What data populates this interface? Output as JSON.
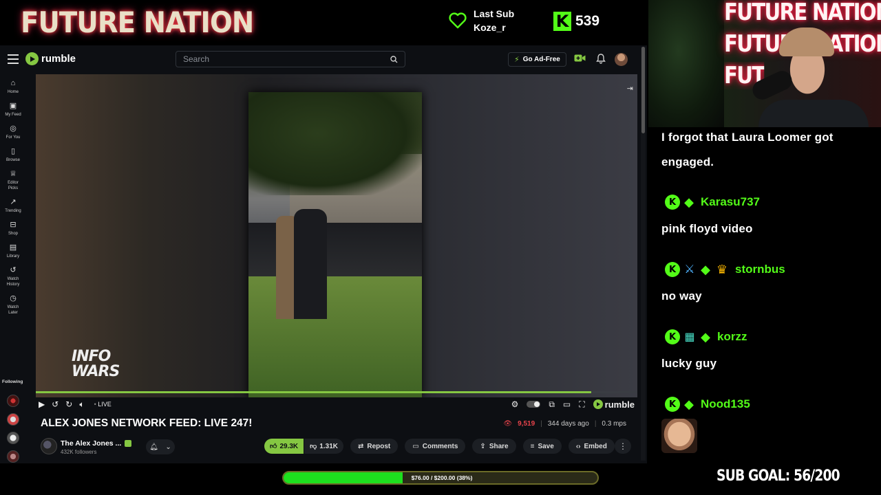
{
  "overlay": {
    "brand_title": "FUTURE NATION",
    "last_sub_label": "Last Sub",
    "last_sub_user": "Koze_r",
    "viewer_count": "539",
    "kick_logo": "K",
    "webcam_neon": [
      "FUTURE NATION",
      "FUTURE NATION",
      "FUTURE NATION"
    ],
    "goal_bar_text": "$76.00 / $200.00 (38%)",
    "goal_bar_progress": 0.38,
    "sub_goal": "SUB GOAL: 56/200",
    "accent_color": "#53fc18"
  },
  "rumble": {
    "logo": "rumble",
    "search_placeholder": "Search",
    "ad_free": "Go Ad-Free",
    "sidebar": [
      {
        "icon": "home-icon",
        "label": "Home"
      },
      {
        "icon": "my-feed-icon",
        "label": "My Feed"
      },
      {
        "icon": "for-you-icon",
        "label": "For You"
      },
      {
        "icon": "browse-icon",
        "label": "Browse"
      },
      {
        "icon": "editor-picks-icon",
        "label": "Editor Picks"
      },
      {
        "icon": "trending-icon",
        "label": "Trending"
      },
      {
        "icon": "shop-icon",
        "label": "Shop"
      },
      {
        "icon": "library-icon",
        "label": "Library"
      },
      {
        "icon": "watch-history-icon",
        "label": "Watch History"
      },
      {
        "icon": "watch-later-icon",
        "label": "Watch Later"
      }
    ],
    "following_label": "Following",
    "player": {
      "watermark": "INFO WARS",
      "live_label": "LIVE",
      "progress": 0.923,
      "logo": "rumble"
    },
    "video": {
      "title": "ALEX JONES NETWORK FEED: LIVE 247!",
      "views": "9,519",
      "time_ago": "344 days ago",
      "bitrate": "0.3 mps",
      "channel_name": "The Alex Jones ...",
      "followers": "432K followers",
      "likes": "29.3K",
      "dislikes": "1.31K",
      "repost": "Repost",
      "comments": "Comments",
      "share": "Share",
      "save": "Save",
      "embed": "Embed"
    },
    "accent_color": "#85c742"
  },
  "chat": {
    "partial_message": [
      "I forgot that Laura Loomer got",
      "engaged."
    ],
    "messages": [
      {
        "user": "Karasu737",
        "text": "pink floyd video",
        "badges": [
          "kick-icon",
          "sub-diamond-icon"
        ]
      },
      {
        "user": "stornbus",
        "text": "no way",
        "badges": [
          "kick-icon",
          "sword-icon",
          "sub-diamond-icon",
          "crown-icon"
        ]
      },
      {
        "user": "korzz",
        "text": "lucky guy",
        "badges": [
          "kick-icon",
          "gift-icon",
          "sub-diamond-icon"
        ]
      },
      {
        "user": "Nood135",
        "text": "",
        "badges": [
          "kick-icon",
          "sub-diamond-icon"
        ],
        "emote": "face-emote"
      }
    ]
  }
}
